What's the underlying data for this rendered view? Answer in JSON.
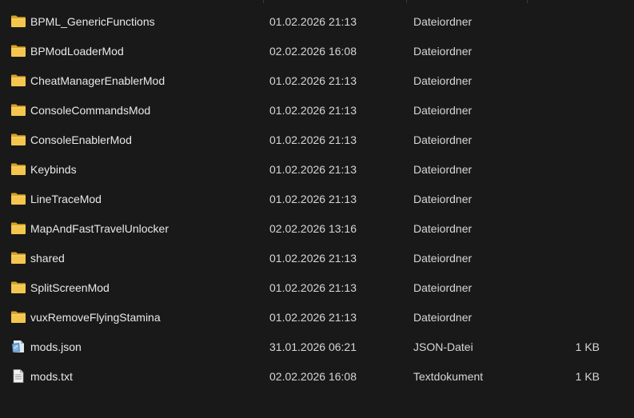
{
  "files": [
    {
      "name": "BPML_GenericFunctions",
      "date": "01.02.2026 21:13",
      "type": "Dateiordner",
      "size": "",
      "icon": "folder-icon"
    },
    {
      "name": "BPModLoaderMod",
      "date": "02.02.2026 16:08",
      "type": "Dateiordner",
      "size": "",
      "icon": "folder-icon"
    },
    {
      "name": "CheatManagerEnablerMod",
      "date": "01.02.2026 21:13",
      "type": "Dateiordner",
      "size": "",
      "icon": "folder-icon"
    },
    {
      "name": "ConsoleCommandsMod",
      "date": "01.02.2026 21:13",
      "type": "Dateiordner",
      "size": "",
      "icon": "folder-icon"
    },
    {
      "name": "ConsoleEnablerMod",
      "date": "01.02.2026 21:13",
      "type": "Dateiordner",
      "size": "",
      "icon": "folder-icon"
    },
    {
      "name": "Keybinds",
      "date": "01.02.2026 21:13",
      "type": "Dateiordner",
      "size": "",
      "icon": "folder-icon"
    },
    {
      "name": "LineTraceMod",
      "date": "01.02.2026 21:13",
      "type": "Dateiordner",
      "size": "",
      "icon": "folder-icon"
    },
    {
      "name": "MapAndFastTravelUnlocker",
      "date": "02.02.2026 13:16",
      "type": "Dateiordner",
      "size": "",
      "icon": "folder-icon"
    },
    {
      "name": "shared",
      "date": "01.02.2026 21:13",
      "type": "Dateiordner",
      "size": "",
      "icon": "folder-icon"
    },
    {
      "name": "SplitScreenMod",
      "date": "01.02.2026 21:13",
      "type": "Dateiordner",
      "size": "",
      "icon": "folder-icon"
    },
    {
      "name": "vuxRemoveFlyingStamina",
      "date": "01.02.2026 21:13",
      "type": "Dateiordner",
      "size": "",
      "icon": "folder-icon"
    },
    {
      "name": "mods.json",
      "date": "31.01.2026 06:21",
      "type": "JSON-Datei",
      "size": "1 KB",
      "icon": "json-file-icon"
    },
    {
      "name": "mods.txt",
      "date": "02.02.2026 16:08",
      "type": "Textdokument",
      "size": "1 KB",
      "icon": "text-file-icon"
    }
  ],
  "colors": {
    "background": "#191919",
    "folder": "#f4c64e",
    "folder_dark": "#d9a324"
  }
}
